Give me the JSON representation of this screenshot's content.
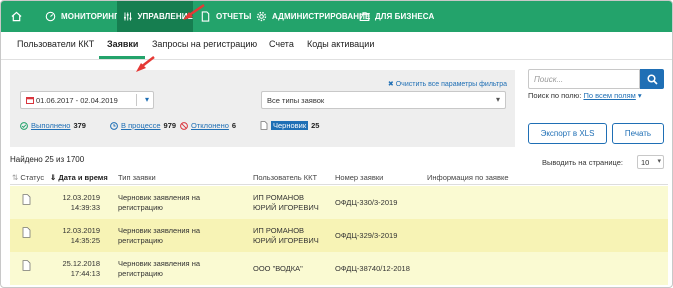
{
  "nav": {
    "items": [
      {
        "label": "МОНИТОРИНГ",
        "icon": "dashboard-icon"
      },
      {
        "label": "УПРАВЛЕНИЕ",
        "icon": "sliders-icon"
      },
      {
        "label": "ОТЧЕТЫ",
        "icon": "document-icon"
      },
      {
        "label": "АДМИНИСТРИРОВАНИЕ",
        "icon": "gear-icon"
      },
      {
        "label": "ДЛЯ БИЗНЕСА",
        "icon": "briefcase-icon"
      }
    ],
    "active_index": 1,
    "home_icon": "home-icon"
  },
  "tabs": [
    {
      "label": "Пользователи ККТ"
    },
    {
      "label": "Заявки",
      "active": true
    },
    {
      "label": "Запросы на регистрацию"
    },
    {
      "label": "Счета"
    },
    {
      "label": "Коды активации"
    }
  ],
  "filter": {
    "clear_label": "Очистить все параметры фильтра",
    "date_range": "01.06.2017 - 02.04.2019",
    "type_select": "Все типы заявок",
    "statuses": [
      {
        "label": "Выполнено",
        "count": "379",
        "icon": "check-circle-icon",
        "color": "#23a36b"
      },
      {
        "label": "В процессе",
        "count": "979",
        "icon": "clock-icon",
        "color": "#1f6fb5"
      },
      {
        "label": "Отклонено",
        "count": "6",
        "icon": "no-entry-icon",
        "color": "#d9363e"
      },
      {
        "label": "Черновик",
        "count": "25",
        "icon": "draft-doc-icon",
        "color": "#1f6fb5"
      }
    ]
  },
  "search": {
    "placeholder": "Поиск...",
    "scope_label": "Поиск по полю:",
    "scope_value": "По всем полям"
  },
  "actions": {
    "export_label": "Экспорт в XLS",
    "print_label": "Печать"
  },
  "results": {
    "found_text": "Найдено 25 из 1700",
    "per_page_label": "Выводить на странице:",
    "per_page_value": "10"
  },
  "table": {
    "headers": {
      "status": "Статус",
      "datetime": "Дата и время",
      "type": "Тип заявки",
      "user": "Пользователь ККТ",
      "number": "Номер заявки",
      "info": "Информация по заявке"
    },
    "rows": [
      {
        "date": "12.03.2019",
        "time": "14:39:33",
        "type_l1": "Черновик заявления на",
        "type_l2": "регистрацию",
        "user_l1": "ИП РОМАНОВ",
        "user_l2": "ЮРИЙ ИГОРЕВИЧ",
        "number": "ОФДЦ-330/3-2019"
      },
      {
        "date": "12.03.2019",
        "time": "14:35:25",
        "type_l1": "Черновик заявления на",
        "type_l2": "регистрацию",
        "user_l1": "ИП РОМАНОВ",
        "user_l2": "ЮРИЙ ИГОРЕВИЧ",
        "number": "ОФДЦ-329/3-2019"
      },
      {
        "date": "25.12.2018",
        "time": "17:44:13",
        "type_l1": "Черновик заявления на",
        "type_l2": "регистрацию",
        "user_l1": "ООО \"ВОДКА\"",
        "user_l2": "",
        "number": "ОФДЦ-38740/12-2018"
      }
    ]
  },
  "colors": {
    "accent": "#23a36b",
    "accent_dark": "#167e50",
    "link": "#1f6fb5",
    "row_bg": "#fafad2",
    "annotation": "#e53935"
  }
}
